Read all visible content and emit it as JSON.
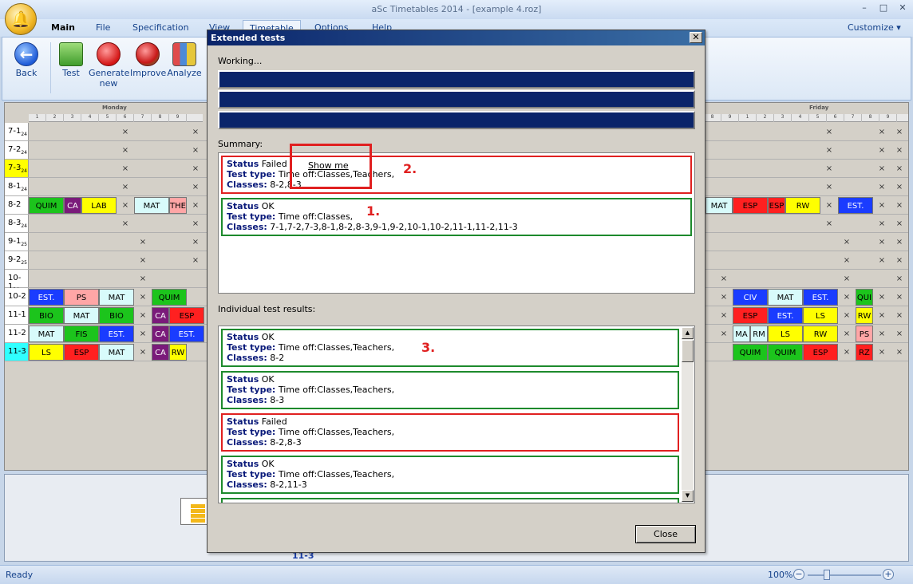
{
  "window": {
    "title": "aSc Timetables 2014  - [example 4.roz]",
    "min": "–",
    "max": "□",
    "close": "✕"
  },
  "menu": {
    "main": "Main",
    "file": "File",
    "specification": "Specification",
    "view": "View",
    "timetable": "Timetable",
    "options": "Options",
    "help": "Help",
    "customize": "Customize ▾"
  },
  "ribbon": {
    "back": "Back",
    "test": "Test",
    "generate": "Generate new",
    "improve": "Improve",
    "analyze": "Analyze"
  },
  "grid": {
    "days": [
      "Monday",
      "Friday"
    ],
    "periods": [
      "1",
      "2",
      "3",
      "4",
      "5",
      "6",
      "7",
      "8",
      "9"
    ],
    "rows": [
      {
        "label": "7-1",
        "sub": "24"
      },
      {
        "label": "7-2",
        "sub": "24"
      },
      {
        "label": "7-3",
        "sub": "24"
      },
      {
        "label": "8-1",
        "sub": "24"
      },
      {
        "label": "8-2",
        "sub": ""
      },
      {
        "label": "8-3",
        "sub": "24"
      },
      {
        "label": "9-1",
        "sub": "25"
      },
      {
        "label": "9-2",
        "sub": "25"
      },
      {
        "label": "10-1",
        "sub": "24"
      },
      {
        "label": "10-2",
        "sub": ""
      },
      {
        "label": "11-1",
        "sub": ""
      },
      {
        "label": "11-2",
        "sub": ""
      },
      {
        "label": "11-3",
        "sub": ""
      }
    ],
    "cells": {
      "r4": [
        "QUIM",
        "CA",
        "LAB",
        "MAT",
        "THE",
        "MAT",
        "ESP",
        "ESP",
        "RW",
        "EST."
      ],
      "r9": [
        "EST.",
        "PS",
        "MAT",
        "QUIM",
        "CIV",
        "MAT",
        "EST.",
        "QUI"
      ],
      "r10": [
        "BIO",
        "MAT",
        "BIO",
        "CA",
        "ESP",
        "ESP",
        "EST.",
        "LS",
        "RW"
      ],
      "r11": [
        "MAT",
        "FIS",
        "EST.",
        "CA",
        "EST.",
        "MA",
        "RM",
        "LS",
        "RW",
        "PS"
      ],
      "r12": [
        "LS",
        "ESP",
        "MAT",
        "CA",
        "RW",
        "QUIM",
        "QUIM",
        "ESP",
        "RZ"
      ]
    },
    "x": "×",
    "bottom_tab": "11-3"
  },
  "colors": {
    "green": "#1cc41c",
    "yellow": "#ffff00",
    "pink": "#ffa6a6",
    "red": "#ff2020",
    "cyan": "#30ffff",
    "lightcyan": "#d8fbfb",
    "blue": "#1a3cff",
    "purple": "#7a1a7a",
    "accent": "#0a246a",
    "okBorder": "#1d8a2c",
    "failBorder": "#e02020"
  },
  "dialog": {
    "title": "Extended tests",
    "close_x": "✕",
    "working": "Working...",
    "summary_label": "Summary:",
    "individual_label": "Individual test results:",
    "show_me": "Show me",
    "close_button": "Close",
    "keys": {
      "status": "Status",
      "type": "Test type:",
      "classes": "Classes:"
    },
    "summary": [
      {
        "status": "Failed",
        "type": "Time off:Classes,Teachers,",
        "classes": "8-2,8-3"
      },
      {
        "status": "OK",
        "type": "Time off:Classes,",
        "classes": "7-1,7-2,7-3,8-1,8-2,8-3,9-1,9-2,10-1,10-2,11-1,11-2,11-3"
      }
    ],
    "results": [
      {
        "status": "OK",
        "type": "Time off:Classes,Teachers,",
        "classes": "8-2"
      },
      {
        "status": "OK",
        "type": "Time off:Classes,Teachers,",
        "classes": "8-3"
      },
      {
        "status": "Failed",
        "type": "Time off:Classes,Teachers,",
        "classes": "8-2,8-3"
      },
      {
        "status": "OK",
        "type": "Time off:Classes,Teachers,",
        "classes": "8-2,11-3"
      }
    ],
    "annotations": {
      "one": "1.",
      "two": "2.",
      "three": "3."
    }
  },
  "status": {
    "ready": "Ready",
    "zoom": "100%",
    "zoom_out": "−",
    "zoom_in": "+"
  }
}
